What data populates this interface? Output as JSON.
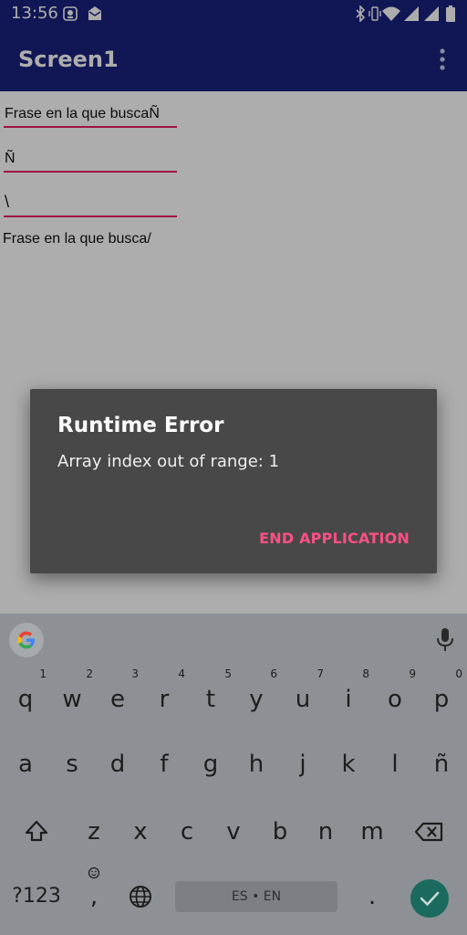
{
  "status_bar": {
    "time": "13:56",
    "icons": [
      "app-notification-icon",
      "mail-icon",
      "bluetooth-icon",
      "vibrate-icon",
      "wifi-icon",
      "signal-icon",
      "signal-icon",
      "battery-icon"
    ]
  },
  "app_bar": {
    "title": "Screen1",
    "menu_icon": "more-vert-icon"
  },
  "form": {
    "field_1": "Frase en la que buscaÑ",
    "field_2": "Ñ",
    "field_3": "\\",
    "result": "Frase en la que busca/"
  },
  "dialog": {
    "title": "Runtime Error",
    "message": "Array index out of range: 1",
    "button": "END APPLICATION"
  },
  "keyboard": {
    "row1": [
      "q",
      "w",
      "e",
      "r",
      "t",
      "y",
      "u",
      "i",
      "o",
      "p"
    ],
    "row1_hints": [
      "1",
      "2",
      "3",
      "4",
      "5",
      "6",
      "7",
      "8",
      "9",
      "0"
    ],
    "row2": [
      "a",
      "s",
      "d",
      "f",
      "g",
      "h",
      "j",
      "k",
      "l",
      "ñ"
    ],
    "row3": [
      "z",
      "x",
      "c",
      "v",
      "b",
      "n",
      "m"
    ],
    "symbols_key": "?123",
    "comma_key": ",",
    "period_key": ".",
    "space_label": "ES • EN",
    "accent": "#1b6a5f"
  },
  "colors": {
    "app_bar": "#1a237e",
    "field_underline": "#e91e63",
    "dialog_background": "#484848",
    "dialog_button": "#ff4f86"
  }
}
